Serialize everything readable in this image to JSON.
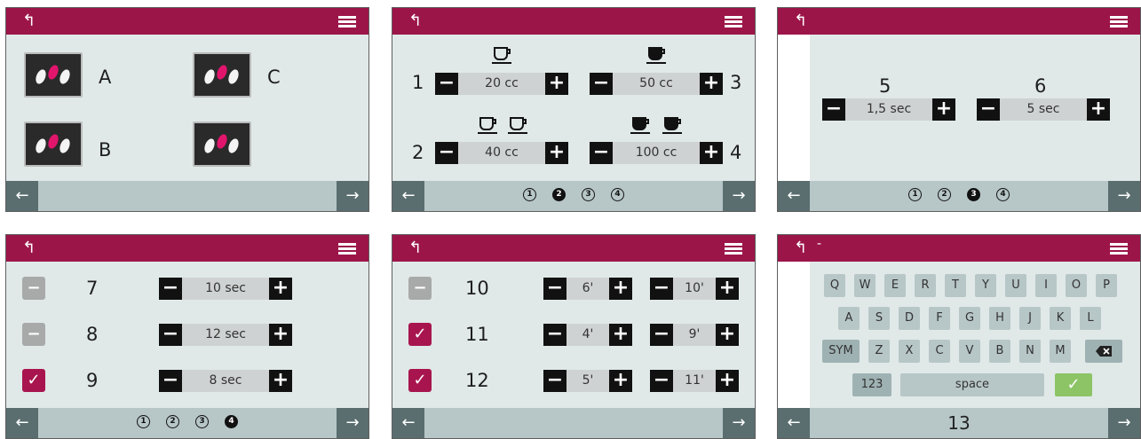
{
  "screens": {
    "s1": {
      "groups": [
        {
          "label": "A"
        },
        {
          "label": "C"
        },
        {
          "label": "B"
        },
        {
          "label": ""
        }
      ]
    },
    "s2": {
      "items": [
        {
          "number": "1",
          "value": "20 cc",
          "cups": 1
        },
        {
          "number": "3",
          "value": "50 cc",
          "cups": 1
        },
        {
          "number": "2",
          "value": "40 cc",
          "cups": 2
        },
        {
          "number": "4",
          "value": "100 cc",
          "cups": 2
        }
      ],
      "pages": [
        "1",
        "2",
        "3",
        "4"
      ],
      "active_page": 2
    },
    "s3": {
      "items": [
        {
          "number": "5",
          "value": "1,5 sec"
        },
        {
          "number": "6",
          "value": "5 sec"
        }
      ],
      "pages": [
        "1",
        "2",
        "3",
        "4"
      ],
      "active_page": 3
    },
    "s4": {
      "rows": [
        {
          "number": "7",
          "value": "10 sec",
          "checked": false
        },
        {
          "number": "8",
          "value": "12 sec",
          "checked": false
        },
        {
          "number": "9",
          "value": "8 sec",
          "checked": true
        }
      ],
      "pages": [
        "1",
        "2",
        "3",
        "4"
      ],
      "active_page": 4
    },
    "s5": {
      "rows": [
        {
          "number": "10",
          "a": "6'",
          "b": "10'",
          "checked": false
        },
        {
          "number": "11",
          "a": "4'",
          "b": "9'",
          "checked": true
        },
        {
          "number": "12",
          "a": "5'",
          "b": "11'",
          "checked": true
        }
      ]
    },
    "s6": {
      "title_dash": "-",
      "row1": [
        "Q",
        "W",
        "E",
        "R",
        "T",
        "Y",
        "U",
        "I",
        "O",
        "P"
      ],
      "row2": [
        "A",
        "S",
        "D",
        "F",
        "G",
        "H",
        "J",
        "K",
        "L"
      ],
      "row3": [
        "Z",
        "X",
        "C",
        "V",
        "B",
        "N",
        "M"
      ],
      "sym": "SYM",
      "num": "123",
      "space": "space",
      "field": "13"
    }
  },
  "icons": {
    "back": "back-arrow-icon",
    "menu": "hamburger-menu-icon",
    "left": "left-arrow-icon",
    "right": "right-arrow-icon",
    "cup": "coffee-cup-icon",
    "beans": "coffee-beans-icon",
    "check": "checkmark-icon",
    "backspace": "backspace-icon"
  },
  "colors": {
    "header": "#9c1549",
    "body": "#e0e9e8",
    "footer": "#b7c6c7",
    "nav_button": "#5a6e70",
    "checked": "#a8154e",
    "confirm": "#8cc466"
  }
}
